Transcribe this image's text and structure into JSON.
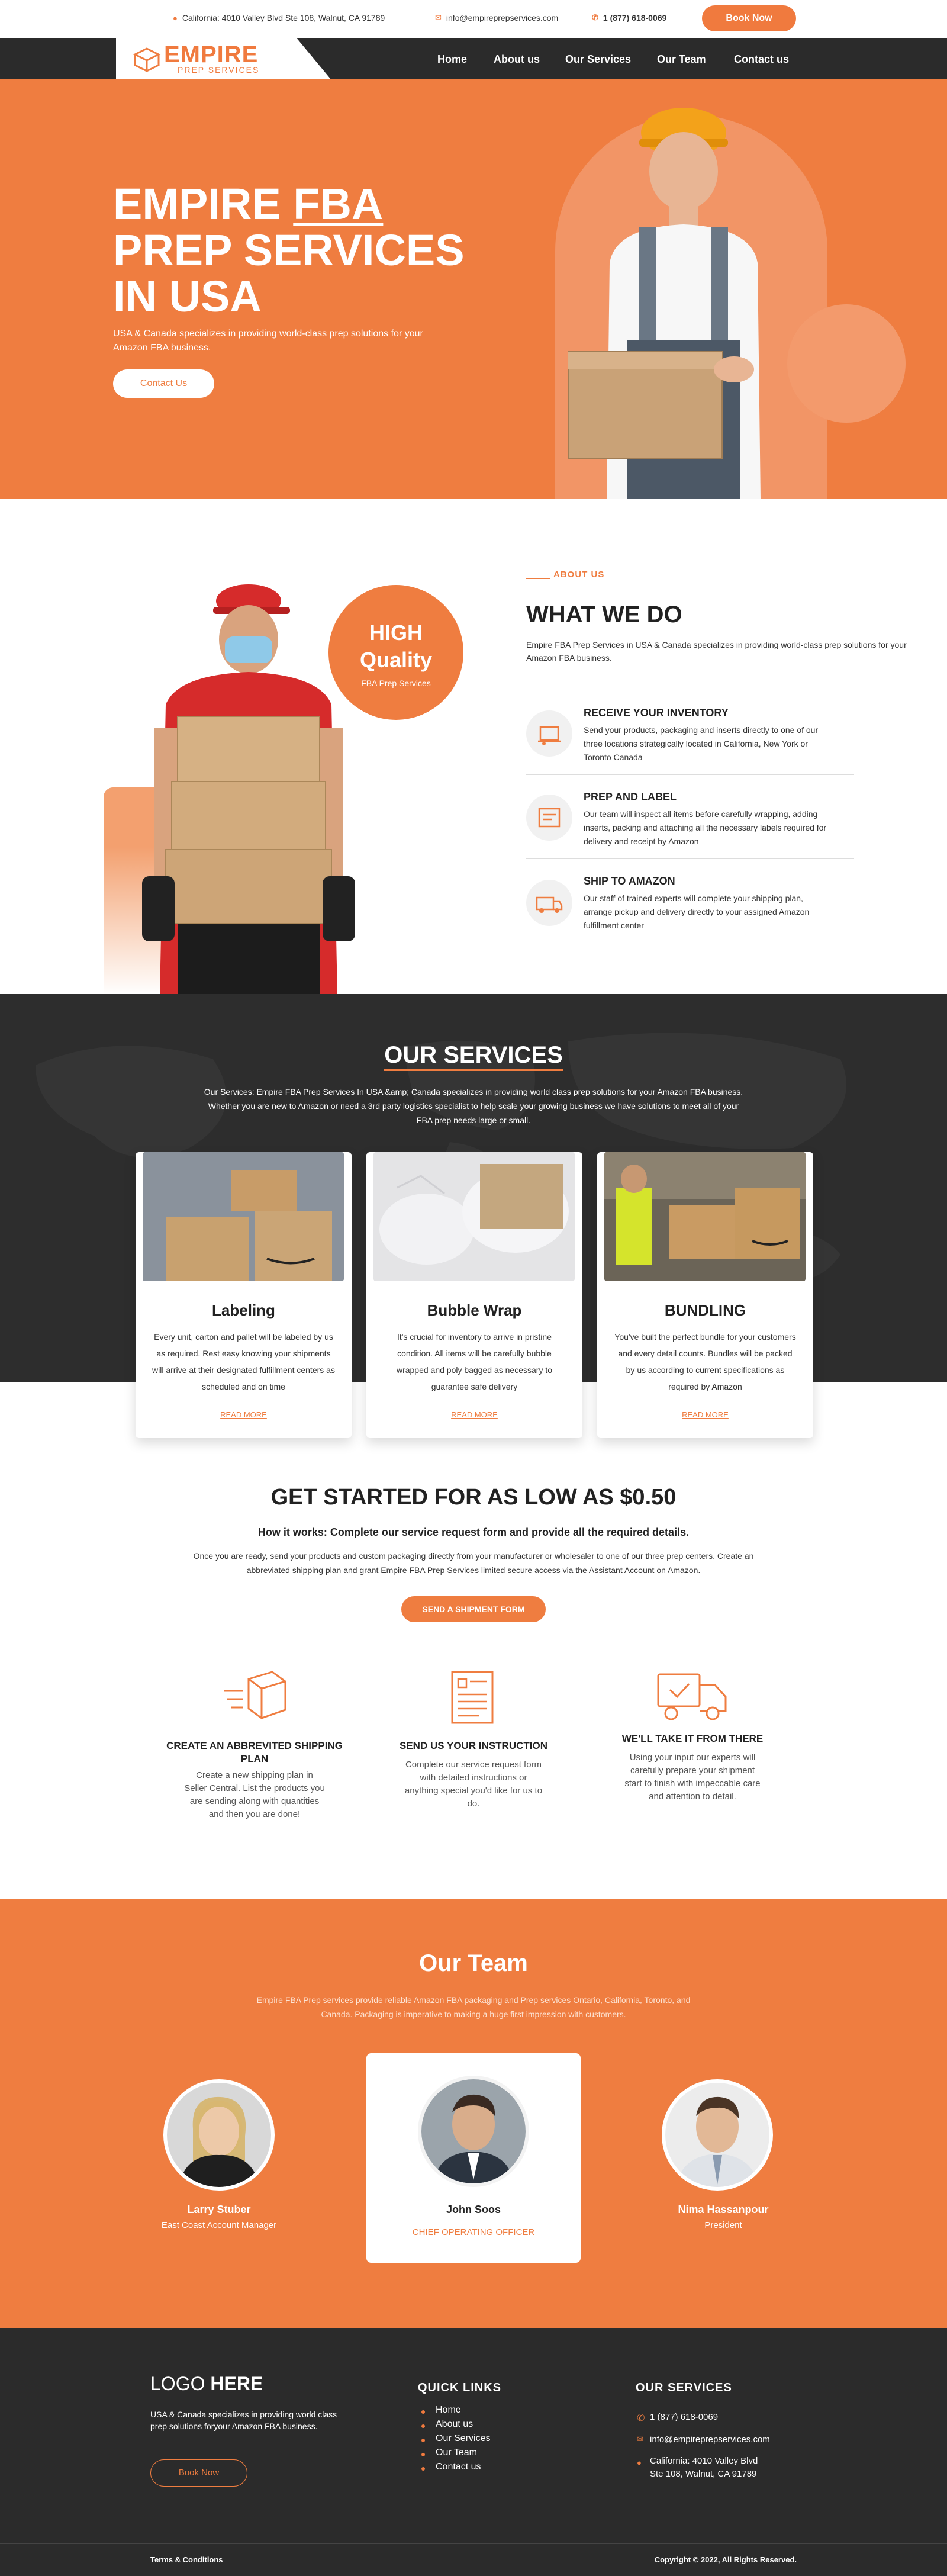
{
  "topbar": {
    "address": "California: 4010 Valley Blvd Ste 108, Walnut, CA 91789",
    "email": "info@empireprepservices.com",
    "phone": "1 (877) 618-0069",
    "book_label": "Book Now"
  },
  "brand": {
    "name": "EMPIRE",
    "tagline": "PREP SERVICES",
    "accent": "#ef7d40",
    "dark": "#2b2b2b"
  },
  "nav": {
    "items": [
      "Home",
      "About us",
      "Our Services",
      "Our Team",
      "Contact us"
    ]
  },
  "hero": {
    "title_1": "EMPIRE",
    "title_2": "FBA",
    "title_3": "PREP SERVICES",
    "title_4": "IN USA",
    "text": "USA & Canada specializes in providing world-class prep solutions for your Amazon FBA business.",
    "button": "Contact Us"
  },
  "about": {
    "badge_1": "HIGH",
    "badge_2": "Quality",
    "badge_3": "FBA Prep Services",
    "label": "ABOUT US",
    "title": "WHAT WE DO",
    "text": "Empire FBA Prep Services in USA & Canada specializes in providing world-class prep solutions for your Amazon FBA business.",
    "features": [
      {
        "title": "RECEIVE YOUR INVENTORY",
        "text": "Send your products, packaging and inserts directly to one of our three locations strategically located in California, New York or Toronto Canada",
        "icon": "inventory-icon"
      },
      {
        "title": "PREP AND LABEL",
        "text": "Our team will inspect all items before carefully wrapping, adding inserts, packing and attaching all the necessary labels required for delivery and receipt by Amazon",
        "icon": "label-icon"
      },
      {
        "title": "SHIP TO AMAZON",
        "text": "Our staff of trained experts will complete your shipping plan, arrange pickup and delivery directly to your assigned Amazon fulfillment center",
        "icon": "truck-icon"
      }
    ]
  },
  "services": {
    "title": "OUR SERVICES",
    "text": "Our Services: Empire FBA Prep Services In USA &amp; Canada specializes in providing world class prep solutions for your Amazon FBA business. Whether you are new to Amazon or need a 3rd party logistics specialist to help scale your growing business we have solutions to meet all of your FBA prep needs large or small.",
    "cards": [
      {
        "title": "Labeling",
        "text": "Every unit, carton and pallet will be labeled by us as required. Rest easy knowing your shipments will arrive at their designated fulfillment centers as scheduled and on time",
        "link": "READ MORE"
      },
      {
        "title": "Bubble Wrap",
        "text": "It's crucial for inventory to arrive in pristine condition. All items will be carefully bubble wrapped and poly bagged as necessary to guarantee safe delivery",
        "link": "READ MORE"
      },
      {
        "title": "BUNDLING",
        "text": "You've built the perfect bundle for your customers and every detail counts. Bundles will be packed by us according to current specifications as required by Amazon",
        "link": "READ MORE"
      }
    ]
  },
  "started": {
    "title": "GET STARTED FOR AS LOW AS $0.50",
    "subtitle": "How it works: Complete our service request form and provide all the required details.",
    "text": "Once you are ready, send your products and custom packaging directly from your manufacturer or wholesaler to one of our three prep centers. Create an abbreviated shipping plan and grant Empire FBA Prep Services limited secure access via the Assistant Account on Amazon.",
    "button": "SEND A SHIPMENT FORM",
    "steps": [
      {
        "title": "CREATE AN ABBREVITED SHIPPING PLAN",
        "text": "Create a new shipping plan in Seller Central. List the products you are sending along with quantities and then you are done!",
        "icon": "box-fast-icon"
      },
      {
        "title": "SEND US YOUR INSTRUCTION",
        "text": "Complete our service request form with detailed instructions or anything special you'd like for us to do.",
        "icon": "document-icon"
      },
      {
        "title": "WE'LL TAKE IT FROM THERE",
        "text": "Using your input our experts will carefully prepare your shipment start to finish with impeccable care and attention to detail.",
        "icon": "delivery-truck-icon"
      }
    ]
  },
  "team": {
    "title": "Our Team",
    "text": "Empire FBA Prep services provide reliable Amazon FBA packaging and Prep services Ontario, California, Toronto, and Canada. Packaging is imperative to making a huge first impression with customers.",
    "members": [
      {
        "name": "Larry Stuber",
        "role": "East Coast Account Manager"
      },
      {
        "name": "John Soos",
        "role": "CHIEF OPERATING OFFICER"
      },
      {
        "name": "Nima Hassanpour",
        "role": "President"
      }
    ]
  },
  "footer": {
    "logo_1": "LOGO",
    "logo_2": "HERE",
    "text": "USA & Canada specializes in providing world class prep solutions foryour Amazon FBA business.",
    "book_label": "Book Now",
    "quick_links_title": "QUICK LINKS",
    "quick_links": [
      "Home",
      "About us",
      "Our Services",
      "Our Team",
      "Contact us"
    ],
    "services_title": "OUR SERVICES",
    "phone": "1 (877) 618-0069",
    "email": "info@empireprepservices.com",
    "address_1": "California: 4010 Valley Blvd",
    "address_2": "Ste 108, Walnut, CA 91789",
    "terms": "Terms & Conditions",
    "copyright": "Copyright © 2022, All Rights Reserved."
  }
}
